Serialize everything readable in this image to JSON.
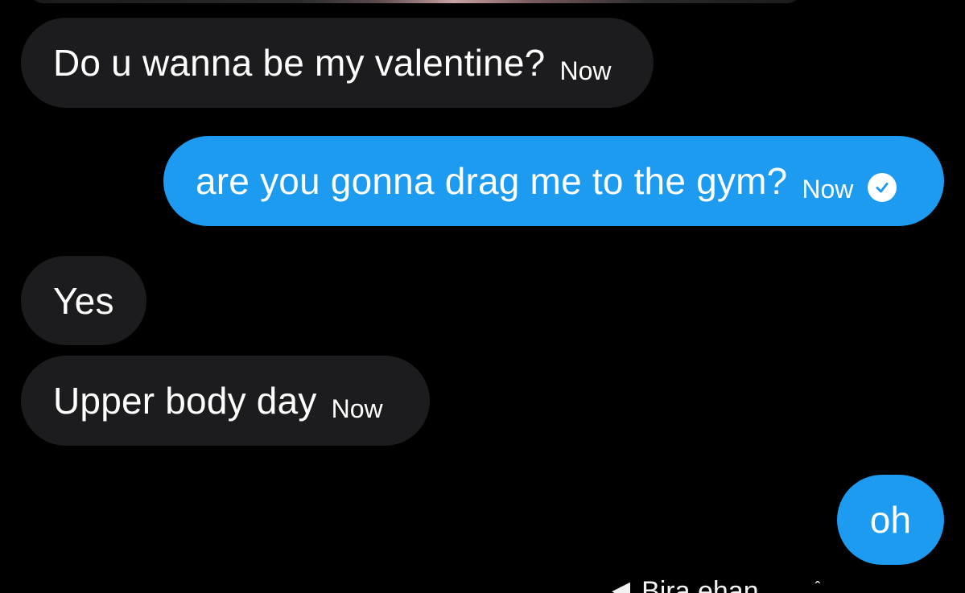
{
  "top_media": {
    "icon": "image-thumbnail"
  },
  "messages": [
    {
      "direction": "incoming",
      "text": "Do u wanna be my valentine?",
      "time": "Now"
    },
    {
      "direction": "outgoing",
      "text": "are you gonna drag me to the gym?",
      "time": "Now",
      "status_icon": "sent-check-icon"
    },
    {
      "direction": "incoming",
      "text": "Yes"
    },
    {
      "direction": "incoming",
      "text": "Upper body day",
      "time": "Now"
    },
    {
      "direction": "outgoing",
      "text": "oh"
    }
  ],
  "bottom_bar": {
    "arrow_icon": "back-arrow",
    "label": "Bira ehan",
    "extra": "ˆ"
  },
  "colors": {
    "background": "#000000",
    "incoming_bubble": "#1c1c1e",
    "outgoing_bubble": "#1d9bf0",
    "text": "#ffffff"
  }
}
